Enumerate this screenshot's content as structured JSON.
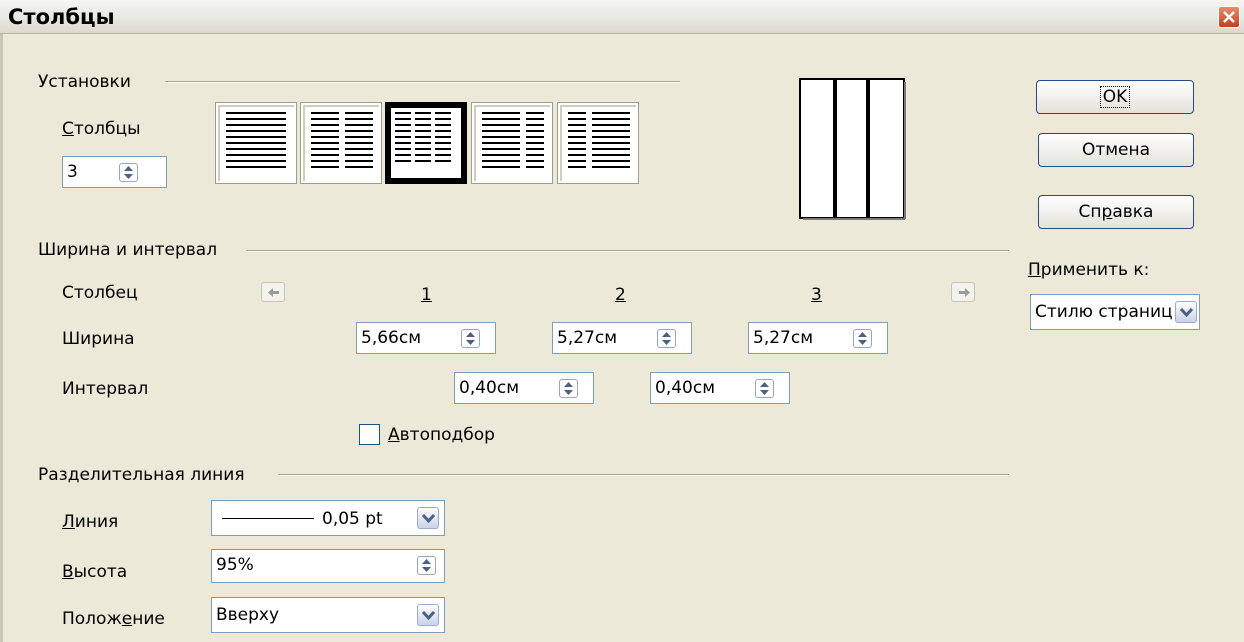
{
  "window": {
    "title": "Столбцы",
    "close_label": "close"
  },
  "settings": {
    "group_label": "Установки",
    "columns_label": "Столбцы",
    "columns_value": "3",
    "layouts": [
      "one-column",
      "two-columns",
      "three-columns",
      "two-columns-left-large",
      "two-columns-right-large"
    ],
    "selected_layout": 2
  },
  "width_spacing": {
    "group_label": "Ширина и интервал",
    "column_label": "Столбец",
    "width_label": "Ширина",
    "spacing_label": "Интервал",
    "column_numbers": [
      "1",
      "2",
      "3"
    ],
    "widths": [
      "5,66см",
      "5,27см",
      "5,27см"
    ],
    "spacings": [
      "0,40см",
      "0,40см"
    ],
    "autofit_label": "Автоподбор",
    "autofit_checked": false
  },
  "separator": {
    "group_label": "Разделительная линия",
    "line_label": "Линия",
    "line_value": "0,05 pt",
    "height_label": "Высота",
    "height_value": "95%",
    "position_label": "Положение",
    "position_value": "Вверху"
  },
  "buttons": {
    "ok": "OK",
    "cancel": "Отмена",
    "help": "Справка"
  },
  "apply": {
    "label": "Применить к:",
    "value": "Стилю страниц"
  },
  "colors": {
    "accent": "#2a4a86",
    "face": "#ECE9D8",
    "close": "#c4401e"
  }
}
